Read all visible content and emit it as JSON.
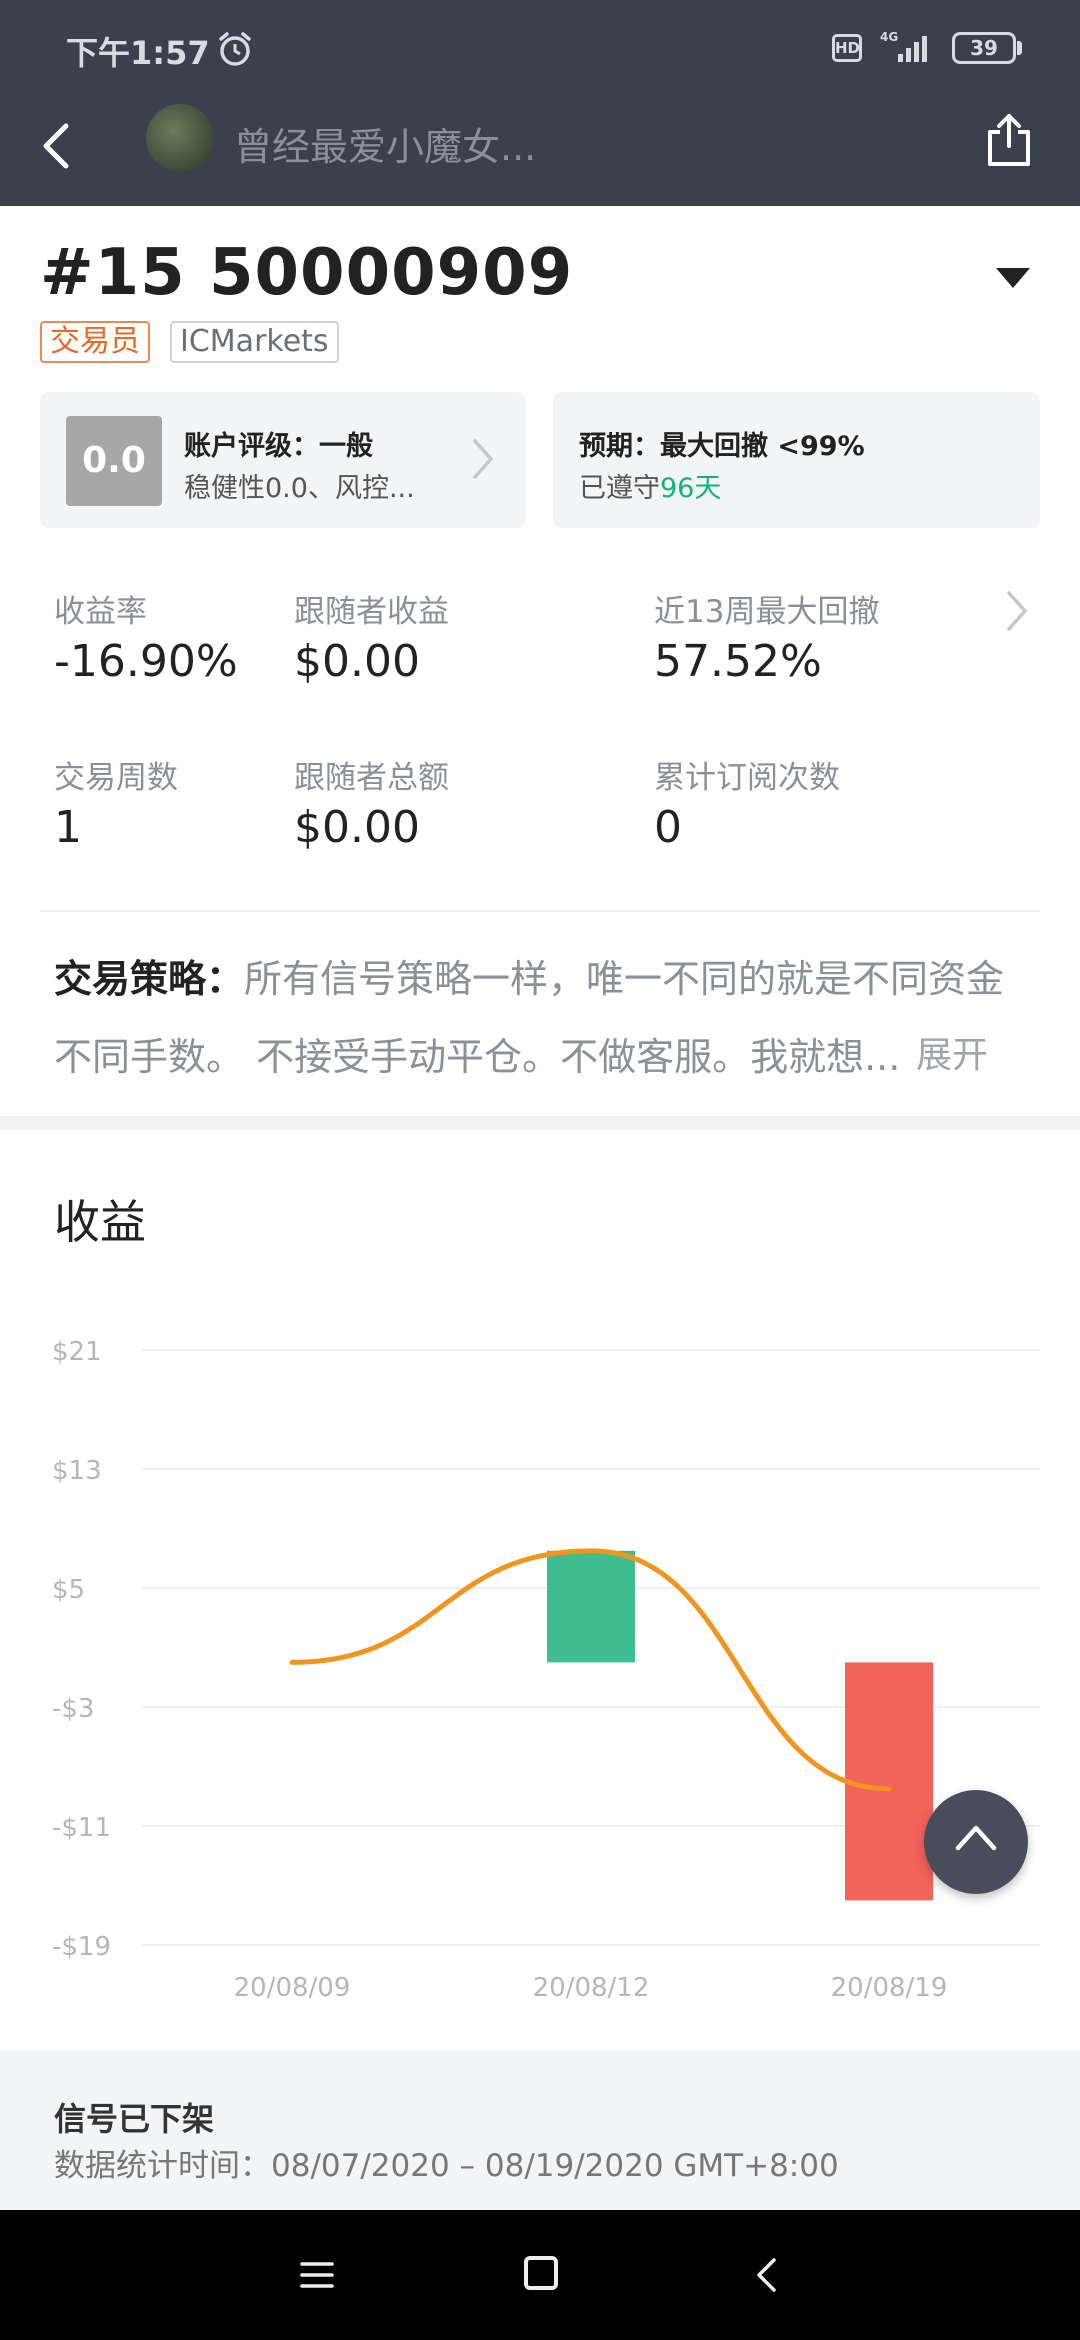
{
  "status_bar": {
    "time": "下午1:57",
    "hd": "HD",
    "network": "4G",
    "battery": "39"
  },
  "app_bar": {
    "title": "曾经最爱小魔女..."
  },
  "account": {
    "title": "#15 50000909",
    "tags": [
      "交易员",
      "ICMarkets"
    ]
  },
  "cards": {
    "rating": {
      "score": "0.0",
      "label": "账户评级：一般",
      "detail": "稳健性0.0、风控..."
    },
    "expectation": {
      "label": "预期：最大回撤 <99%",
      "detail_prefix": "已遵守",
      "detail_days": "96天"
    }
  },
  "stats": [
    {
      "label": "收益率",
      "value": "-16.90%"
    },
    {
      "label": "跟随者收益",
      "value": "$0.00"
    },
    {
      "label": "近13周最大回撤",
      "value": "57.52%"
    },
    {
      "label": "交易周数",
      "value": "1"
    },
    {
      "label": "跟随者总额",
      "value": "$0.00"
    },
    {
      "label": "累计订阅次数",
      "value": "0"
    }
  ],
  "strategy": {
    "label": "交易策略：",
    "text": "所有信号策略一样，唯一不同的就是不同资金不同手数。 不接受手动平仓。不做客服。我就想...",
    "expand": "展开"
  },
  "section_title": "收益",
  "colors": {
    "gain": "#3dbd90",
    "loss": "#f2635a",
    "line": "#f0951e",
    "accent_green": "#17b07a"
  },
  "chart_data": {
    "type": "bar",
    "categories": [
      "20/08/09",
      "20/08/12",
      "20/08/19"
    ],
    "ylim": [
      -19,
      21
    ],
    "yticks": [
      "$21",
      "$13",
      "$5",
      "-$3",
      "-$11",
      "-$19"
    ],
    "ytick_values": [
      21,
      13,
      5,
      -3,
      -11,
      -19
    ],
    "bars": [
      {
        "category": "20/08/12",
        "from": 0,
        "to": 7.5
      },
      {
        "category": "20/08/19",
        "from": 0,
        "to": -16
      }
    ],
    "line": {
      "values": [
        0,
        7.5,
        -8.5
      ]
    }
  },
  "footer": {
    "title": "信号已下架",
    "subtitle": "数据统计时间：08/07/2020 – 08/19/2020 GMT+8:00"
  }
}
